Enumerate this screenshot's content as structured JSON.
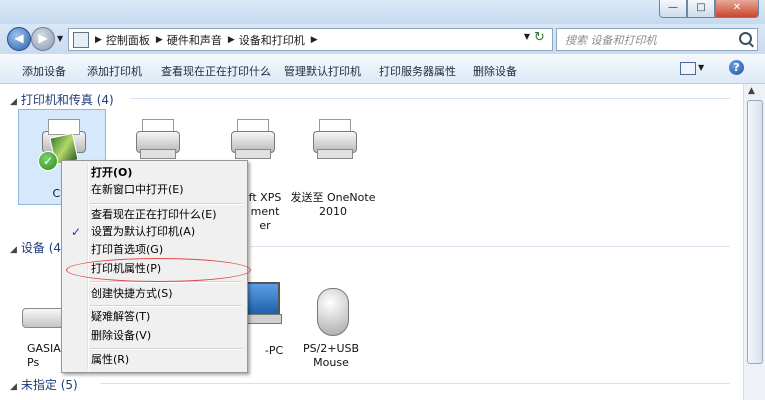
{
  "window": {
    "minimize_glyph": "—",
    "maximize_glyph": "□",
    "close_glyph": "✕"
  },
  "address": {
    "crumbs": [
      "控制面板",
      "硬件和声音",
      "设备和打印机"
    ],
    "search_placeholder": "搜索 设备和打印机"
  },
  "toolbar": {
    "items": [
      "添加设备",
      "添加打印机",
      "查看现在正在打印什么",
      "管理默认打印机",
      "打印服务器属性",
      "删除设备"
    ]
  },
  "groups": {
    "printers": "打印机和传真 (4)",
    "devices": "设备 (4",
    "unspecified": "未指定 (5)"
  },
  "printers": [
    {
      "label": "Car",
      "selected": true,
      "default": true
    },
    {
      "label": "",
      "selected": false
    },
    {
      "label": "ft XPS\nment\ner",
      "selected": false
    },
    {
      "label": "发送至 OneNote\n2010",
      "selected": false
    }
  ],
  "devices": [
    {
      "label": "GASIA\nPs"
    },
    {
      "label": ""
    },
    {
      "label": "-PC"
    },
    {
      "label": "PS/2+USB\nMouse"
    }
  ],
  "context_menu": {
    "items": [
      {
        "label": "打开(O)",
        "bold": true
      },
      {
        "label": "在新窗口中打开(E)"
      },
      {
        "label": "查看现在正在打印什么(E)"
      },
      {
        "label": "设置为默认打印机(A)",
        "checked": true
      },
      {
        "label": "打印首选项(G)"
      },
      {
        "label": "打印机属性(P)"
      },
      {
        "label": "创建快捷方式(S)"
      },
      {
        "label": "疑难解答(T)"
      },
      {
        "label": "删除设备(V)"
      },
      {
        "label": "属性(R)"
      }
    ]
  }
}
